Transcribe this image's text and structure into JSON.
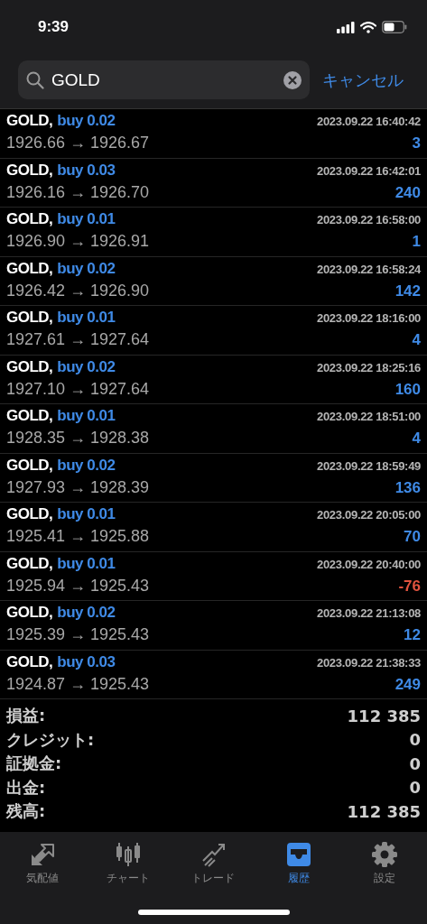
{
  "status_bar": {
    "time": "9:39"
  },
  "search": {
    "value": "GOLD",
    "cancel": "キャンセル"
  },
  "deals": [
    {
      "symbol": "GOLD,",
      "side": "buy 0.02",
      "time": "2023.09.22 16:40:42",
      "prices": "1926.66 → 1926.67",
      "profit": "3",
      "negative": false
    },
    {
      "symbol": "GOLD,",
      "side": "buy 0.03",
      "time": "2023.09.22 16:42:01",
      "prices": "1926.16 → 1926.70",
      "profit": "240",
      "negative": false
    },
    {
      "symbol": "GOLD,",
      "side": "buy 0.01",
      "time": "2023.09.22 16:58:00",
      "prices": "1926.90 → 1926.91",
      "profit": "1",
      "negative": false
    },
    {
      "symbol": "GOLD,",
      "side": "buy 0.02",
      "time": "2023.09.22 16:58:24",
      "prices": "1926.42 → 1926.90",
      "profit": "142",
      "negative": false
    },
    {
      "symbol": "GOLD,",
      "side": "buy 0.01",
      "time": "2023.09.22 18:16:00",
      "prices": "1927.61 → 1927.64",
      "profit": "4",
      "negative": false
    },
    {
      "symbol": "GOLD,",
      "side": "buy 0.02",
      "time": "2023.09.22 18:25:16",
      "prices": "1927.10 → 1927.64",
      "profit": "160",
      "negative": false
    },
    {
      "symbol": "GOLD,",
      "side": "buy 0.01",
      "time": "2023.09.22 18:51:00",
      "prices": "1928.35 → 1928.38",
      "profit": "4",
      "negative": false
    },
    {
      "symbol": "GOLD,",
      "side": "buy 0.02",
      "time": "2023.09.22 18:59:49",
      "prices": "1927.93 → 1928.39",
      "profit": "136",
      "negative": false
    },
    {
      "symbol": "GOLD,",
      "side": "buy 0.01",
      "time": "2023.09.22 20:05:00",
      "prices": "1925.41 → 1925.88",
      "profit": "70",
      "negative": false
    },
    {
      "symbol": "GOLD,",
      "side": "buy 0.01",
      "time": "2023.09.22 20:40:00",
      "prices": "1925.94 → 1925.43",
      "profit": "-76",
      "negative": true
    },
    {
      "symbol": "GOLD,",
      "side": "buy 0.02",
      "time": "2023.09.22 21:13:08",
      "prices": "1925.39 → 1925.43",
      "profit": "12",
      "negative": false
    },
    {
      "symbol": "GOLD,",
      "side": "buy 0.03",
      "time": "2023.09.22 21:38:33",
      "prices": "1924.87 → 1925.43",
      "profit": "249",
      "negative": false
    }
  ],
  "summary": [
    {
      "label": "損益:",
      "value": "112 385"
    },
    {
      "label": "クレジット:",
      "value": "0"
    },
    {
      "label": "証拠金:",
      "value": "0"
    },
    {
      "label": "出金:",
      "value": "0"
    },
    {
      "label": "残高:",
      "value": "112 385"
    }
  ],
  "tabs": [
    {
      "kind": "quotes",
      "label": "気配値",
      "selected": false
    },
    {
      "kind": "chart",
      "label": "チャート",
      "selected": false
    },
    {
      "kind": "trade",
      "label": "トレード",
      "selected": false
    },
    {
      "kind": "history",
      "label": "履歴",
      "selected": true
    },
    {
      "kind": "settings",
      "label": "設定",
      "selected": false
    }
  ]
}
